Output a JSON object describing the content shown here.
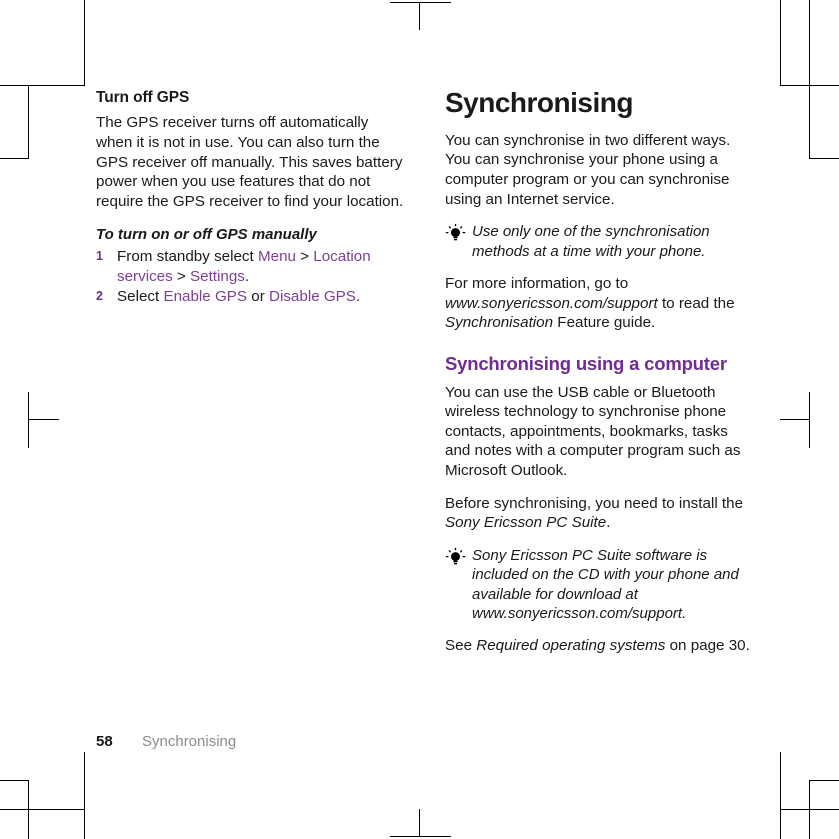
{
  "page": {
    "folio": "58",
    "running_head": "Synchronising"
  },
  "left_column": {
    "sub_head": "Turn off GPS",
    "intro_paragraph": "The GPS receiver turns off automatically when it is not in use. You can also turn the GPS receiver off manually. This saves battery power when you use features that do not require the GPS receiver to find your location.",
    "procedure_title": "To turn on or off GPS manually",
    "steps": [
      {
        "number": "1",
        "segments": [
          {
            "text": "From standby select ",
            "style": "plain"
          },
          {
            "text": "Menu",
            "style": "link"
          },
          {
            "text": " > ",
            "style": "plain"
          },
          {
            "text": "Location services",
            "style": "link"
          },
          {
            "text": " > ",
            "style": "plain"
          },
          {
            "text": "Settings",
            "style": "link"
          },
          {
            "text": ".",
            "style": "plain"
          }
        ]
      },
      {
        "number": "2",
        "segments": [
          {
            "text": "Select ",
            "style": "plain"
          },
          {
            "text": "Enable GPS",
            "style": "link"
          },
          {
            "text": " or ",
            "style": "plain"
          },
          {
            "text": "Disable GPS",
            "style": "link"
          },
          {
            "text": ".",
            "style": "plain"
          }
        ]
      }
    ]
  },
  "right_column": {
    "chapter_title": "Synchronising",
    "intro_paragraph": "You can synchronise in two different ways. You can synchronise your phone using a computer program or you can synchronise using an Internet service.",
    "tip_one": {
      "icon": "lightbulb-icon",
      "text": "Use only one of the synchronisation methods at a time with your phone."
    },
    "more_info": {
      "segments": [
        {
          "text": "For more information, go to ",
          "style": "plain"
        },
        {
          "text": "www.sonyericsson.com/support",
          "style": "italic"
        },
        {
          "text": " to read the ",
          "style": "plain"
        },
        {
          "text": "Synchronisation",
          "style": "italic"
        },
        {
          "text": " Feature guide.",
          "style": "plain"
        }
      ]
    },
    "section_title": "Synchronising using a computer",
    "computer_paragraph": "You can use the USB cable or Bluetooth wireless technology to synchronise phone contacts, appointments, bookmarks, tasks and notes with a computer program such as Microsoft Outlook.",
    "install_paragraph": {
      "segments": [
        {
          "text": "Before synchronising, you need to install the ",
          "style": "plain"
        },
        {
          "text": "Sony Ericsson PC Suite",
          "style": "italic"
        },
        {
          "text": ".",
          "style": "plain"
        }
      ]
    },
    "tip_two": {
      "icon": "lightbulb-icon",
      "text": "Sony Ericsson PC Suite software is included on the CD with your phone and available for download at www.sonyericsson.com/support."
    },
    "see_also": {
      "segments": [
        {
          "text": "See ",
          "style": "plain"
        },
        {
          "text": "Required operating systems",
          "style": "italic"
        },
        {
          "text": " on page 30.",
          "style": "plain"
        }
      ]
    }
  },
  "colors": {
    "accent_purple": "#6f2c91",
    "link_purple": "#7d3f98",
    "body_text": "#1a1a1a",
    "footer_gray": "#8c8c8c"
  }
}
